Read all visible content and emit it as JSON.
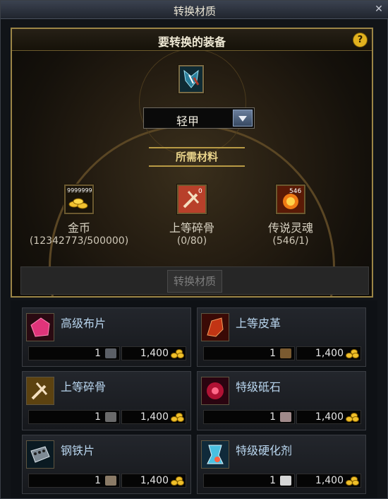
{
  "window": {
    "title": "转换材质"
  },
  "equip": {
    "heading": "要转换的装备",
    "help": "?",
    "selected_type": "轻甲"
  },
  "required": {
    "label": "所需材料",
    "items": [
      {
        "icon": "gold-icon",
        "badge": "9999999",
        "name": "金币",
        "count": "(12342773/500000)"
      },
      {
        "icon": "bone-fragment-icon",
        "badge": "0",
        "name": "上等碎骨",
        "count": "(0/80)"
      },
      {
        "icon": "legendary-soul-icon",
        "badge": "546",
        "name": "传说灵魂",
        "count": "(546/1)"
      }
    ]
  },
  "convert_button": "转换材质",
  "shop": [
    {
      "name": "高级布片",
      "qty": "1",
      "price": "1,400",
      "icon": "cloth-icon"
    },
    {
      "name": "上等皮革",
      "qty": "1",
      "price": "1,400",
      "icon": "leather-icon"
    },
    {
      "name": "上等碎骨",
      "qty": "1",
      "price": "1,400",
      "icon": "bone-icon"
    },
    {
      "name": "特级砥石",
      "qty": "1",
      "price": "1,400",
      "icon": "whetstone-icon"
    },
    {
      "name": "钢铁片",
      "qty": "1",
      "price": "1,400",
      "icon": "steel-plate-icon"
    },
    {
      "name": "特级硬化剂",
      "qty": "1",
      "price": "1,400",
      "icon": "hardener-icon"
    }
  ],
  "colors": {
    "accent": "#9b8546",
    "label_blue": "#b9d6ef",
    "gold": "#f0c02a"
  }
}
